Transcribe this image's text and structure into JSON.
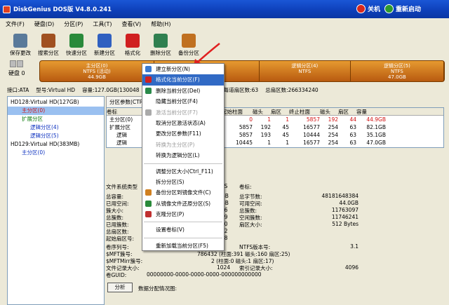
{
  "titlebar": {
    "title": "DiskGenius DOS版 V4.8.0.241",
    "shutdown": "关机",
    "restart": "重新启动"
  },
  "menubar": [
    "文件(F)",
    "硬盘(D)",
    "分区(P)",
    "工具(T)",
    "查看(V)",
    "帮助(H)"
  ],
  "toolbar": [
    {
      "label": "保存更改",
      "icon": "save-icon",
      "color": "#5a7a9a"
    },
    {
      "label": "搜索分区",
      "icon": "search-icon",
      "color": "#a05020"
    },
    {
      "label": "快速分区",
      "icon": "quick-partition-icon",
      "color": "#2a8a3a"
    },
    {
      "label": "新建分区",
      "icon": "new-partition-icon",
      "color": "#3060c0"
    },
    {
      "label": "格式化",
      "icon": "format-icon",
      "color": "#d02020"
    },
    {
      "label": "删除分区",
      "icon": "delete-icon",
      "color": "#308050"
    },
    {
      "label": "备份分区",
      "icon": "backup-icon",
      "color": "#c07020"
    }
  ],
  "disk": {
    "label": "硬盘 0"
  },
  "partbar": [
    {
      "line1": "主分区(0)",
      "line2": "NTFS (活动)",
      "line3": "44.9GB",
      "share": 0.283
    },
    {
      "line1": "",
      "line2": "",
      "line3": "",
      "share": 0.26
    },
    {
      "line1": "逻辑分区(4)",
      "line2": "NTFS",
      "line3": "",
      "share": 0.226
    },
    {
      "line1": "逻辑分区(5)",
      "line2": "NTFS",
      "line3": "47.0GB",
      "share": 0.231
    }
  ],
  "infoline": [
    "接口:ATA",
    "型号:Virtual HD",
    "容量:127.0GB(130048",
    "每道扇区数:63",
    "总扇区数:266334240"
  ],
  "tree": [
    {
      "text": "HD128:Virtual HD(127GB)",
      "cls": ""
    },
    {
      "text": "主分区(0)",
      "cls": "red sel"
    },
    {
      "text": "扩展分区",
      "cls": "green"
    },
    {
      "text": "逻辑分区(4)",
      "cls": "blue"
    },
    {
      "text": "逻辑分区(5)",
      "cls": "blue"
    },
    {
      "text": "HD129:Virtual HD(383MB)",
      "cls": ""
    },
    {
      "text": "主分区(0)",
      "cls": "blue"
    }
  ],
  "tabs": [
    "分区参数(CTRL",
    "浏览文件"
  ],
  "grid": {
    "headers": [
      "卷标",
      "",
      "件系统",
      "标识",
      "起始柱面",
      "磁头",
      "扇区",
      "终止柱面",
      "磁头",
      "扇区",
      "容量"
    ],
    "rows": [
      {
        "name": "主分区(0)",
        "fs": "NTFS",
        "id": "07",
        "c1": "0",
        "h1": "1",
        "s1": "1",
        "c2": "5857",
        "h2": "192",
        "s2": "44",
        "size": "44.9GB",
        "cls": "red"
      },
      {
        "name": "扩展分区",
        "fs": "EXTEND",
        "id": "0F",
        "c1": "5857",
        "h1": "192",
        "s1": "45",
        "c2": "16577",
        "h2": "254",
        "s2": "63",
        "size": "82.1GB",
        "cls": ""
      },
      {
        "name": "逻辑",
        "fs": "NTFS",
        "id": "07",
        "c1": "5857",
        "h1": "193",
        "s1": "45",
        "c2": "10444",
        "h2": "254",
        "s2": "63",
        "size": "35.1GB",
        "cls": "blue"
      },
      {
        "name": "逻辑",
        "fs": "NTFS",
        "id": "07",
        "c1": "10445",
        "h1": "1",
        "s1": "1",
        "c2": "16577",
        "h2": "254",
        "s2": "63",
        "size": "47.0GB",
        "cls": "blue"
      }
    ]
  },
  "fs": {
    "fstype_label": "文件系统类型",
    "fstype": "TS",
    "vol_label": "卷标:",
    "rows_left": [
      "总容量:",
      "已用空间:",
      "簇大小:",
      "总簇数:",
      "已用簇数:",
      "总扇区数:",
      "起始扇区号:"
    ],
    "rows_mid": [
      "GB",
      "GB",
      "96",
      "39",
      "40",
      "32",
      "08"
    ],
    "rows_right_labels": [
      "总字节数:",
      "可用空间:",
      "总簇数:",
      "空闲簇数:",
      "扇区大小:"
    ],
    "rows_right_values": [
      "48181648384",
      "44.0GB",
      "11763097",
      "11746241",
      "512 Bytes"
    ],
    "serial_label": "卷序列号:",
    "serial_val": "2",
    "ntfs_label": "NTFS版本号:",
    "ntfs_val": "3.1",
    "mft_label": "$MFT簇号:",
    "mft_val": "786432 (柱面:391 磁头:160 扇区:25)",
    "mftm_label": "$MFTMirr簇号:",
    "mftm_val": "2 (柱面:0 磁头:1 扇区:17)",
    "rec_label": "文件记录大小:",
    "rec_val": "1024",
    "idx_label": "索引记录大小:",
    "idx_val": "4096",
    "guid_label": "卷GUID:",
    "guid_val": "00000000-0000-0000-0000-000000000000"
  },
  "analyze": {
    "button": "分析",
    "label": "数据分配情况图:"
  },
  "menu": [
    {
      "label": "建立新分区(N)",
      "state": "normal",
      "icon": "#3a7ad0"
    },
    {
      "label": "格式化当前分区(F)",
      "state": "highlight",
      "icon": "#d02020"
    },
    {
      "label": "删除当前分区(Del)",
      "state": "normal",
      "icon": "#2a8a4a"
    },
    {
      "label": "隐藏当前分区(F4)",
      "state": "normal",
      "icon": ""
    },
    {
      "label": "激活当前分区(F7)",
      "state": "disabled",
      "icon": "#aaaaaa"
    },
    {
      "label": "取消分区激活状态(A)",
      "state": "normal",
      "icon": ""
    },
    {
      "label": "更改分区参数(F11)",
      "state": "normal",
      "icon": ""
    },
    {
      "label": "转换为主分区(P)",
      "state": "disabled",
      "icon": ""
    },
    {
      "label": "转换为逻辑分区(L)",
      "state": "normal",
      "icon": ""
    },
    {
      "sep": true
    },
    {
      "label": "调整分区大小(Ctrl_F11)",
      "state": "normal",
      "icon": ""
    },
    {
      "label": "拆分分区(S)",
      "state": "normal",
      "icon": ""
    },
    {
      "label": "备份分区到镜像文件(C)",
      "state": "normal",
      "icon": "#d08020"
    },
    {
      "label": "从镜像文件还原分区(S)",
      "state": "normal",
      "icon": "#2a8a3a"
    },
    {
      "label": "克隆分区(P)",
      "state": "normal",
      "icon": "#c03030"
    },
    {
      "sep": true
    },
    {
      "label": "设置卷标(V)",
      "state": "normal",
      "icon": ""
    },
    {
      "sep": true
    },
    {
      "label": "重新加载当前分区(F5)",
      "state": "normal",
      "icon": ""
    }
  ]
}
